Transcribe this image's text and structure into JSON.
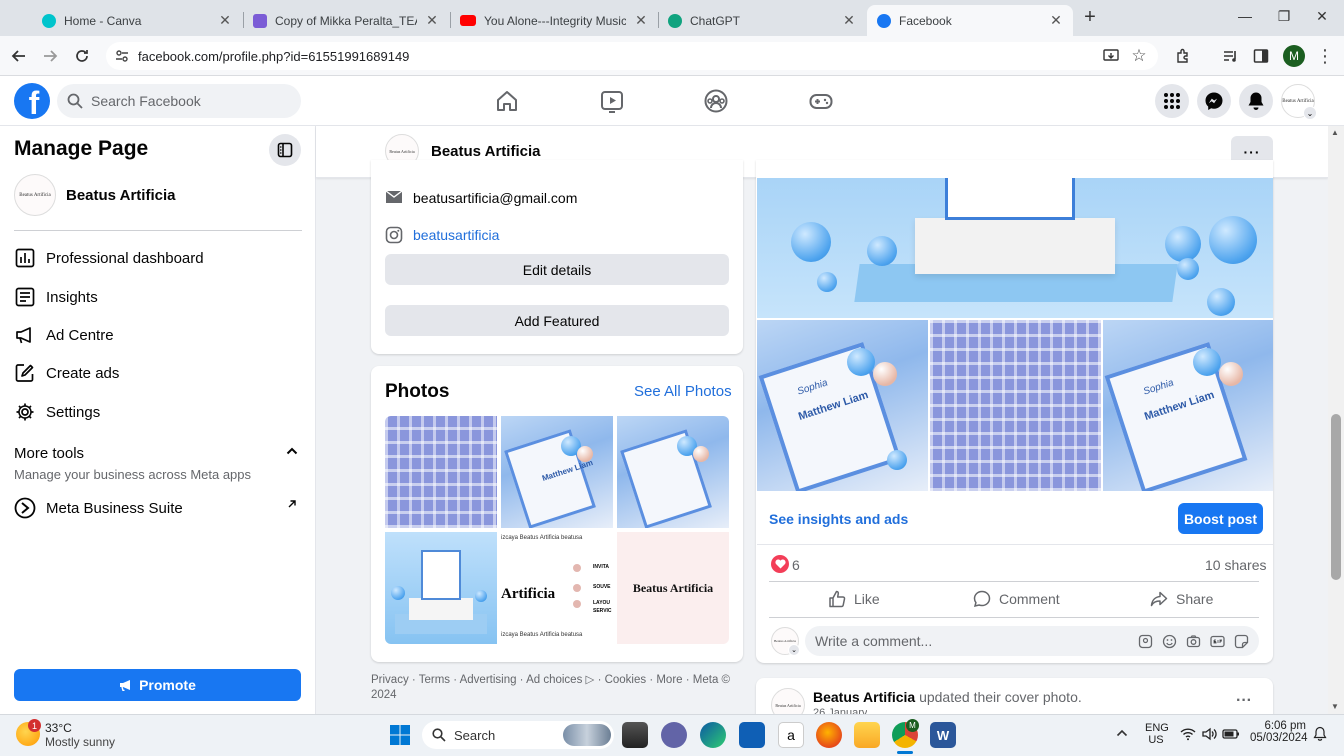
{
  "browser": {
    "tabs": [
      {
        "title": "Home - Canva",
        "favicon_color": "#00c4cc"
      },
      {
        "title": "Copy of Mikka Peralta_TEA Inte",
        "favicon_color": "#7b5cd6"
      },
      {
        "title": "You Alone---Integrity Music wit",
        "favicon_color": "#ff0000"
      },
      {
        "title": "ChatGPT",
        "favicon_color": "#10a37f"
      },
      {
        "title": "Facebook",
        "favicon_color": "#1877f2"
      }
    ],
    "new_tab": "+",
    "url": "facebook.com/profile.php?id=61551991689149",
    "profile_initial": "M"
  },
  "fb": {
    "search_placeholder": "Search Facebook",
    "brand_color": "#1877f2"
  },
  "sidebar": {
    "title": "Manage Page",
    "page_name": "Beatus Artificia",
    "avatar_text": "Beatus Artificia",
    "items": [
      {
        "label": "Professional dashboard"
      },
      {
        "label": "Insights"
      },
      {
        "label": "Ad Centre"
      },
      {
        "label": "Create ads"
      },
      {
        "label": "Settings"
      }
    ],
    "more_tools": {
      "title": "More tools",
      "subtitle": "Manage your business across Meta apps",
      "meta_suite": "Meta Business Suite"
    },
    "promote": "Promote"
  },
  "page_header": {
    "name": "Beatus Artificia"
  },
  "intro": {
    "email": "beatusartificia@gmail.com",
    "instagram": "beatusartificia",
    "edit_details": "Edit details",
    "add_featured": "Add Featured"
  },
  "photos": {
    "title": "Photos",
    "see_all": "See All Photos",
    "tile_text": {
      "brand": "Artificia",
      "brand_full": "Beatus Artificia",
      "strip_top": "izcaya  Beatus Artificia  beatusa",
      "strip_bottom": "izcaya  Beatus Artificia  beatusa",
      "list": [
        "INVITA",
        "SOUVE",
        "LAYOU",
        "SERVIC"
      ]
    },
    "invite_text": {
      "name_top": "Sophia",
      "name": "Matthew Liam"
    }
  },
  "footer": {
    "links": "Privacy · Terms · Advertising · Ad choices ▷ · Cookies · More · Meta © 2024"
  },
  "post": {
    "see_insights": "See insights and ads",
    "boost": "Boost post",
    "reactions": "6",
    "shares": "10 shares",
    "like": "Like",
    "comment": "Comment",
    "share": "Share",
    "comment_placeholder": "Write a comment...",
    "avatar_text": "Beatus Artificia"
  },
  "next_post": {
    "author": "Beatus Artificia",
    "action": "updated their cover photo.",
    "date": "26 January"
  },
  "taskbar": {
    "temp": "33°C",
    "weather": "Mostly sunny",
    "weather_badge": "1",
    "search": "Search",
    "lang1": "ENG",
    "lang2": "US",
    "time": "6:06 pm",
    "date": "05/03/2024"
  }
}
